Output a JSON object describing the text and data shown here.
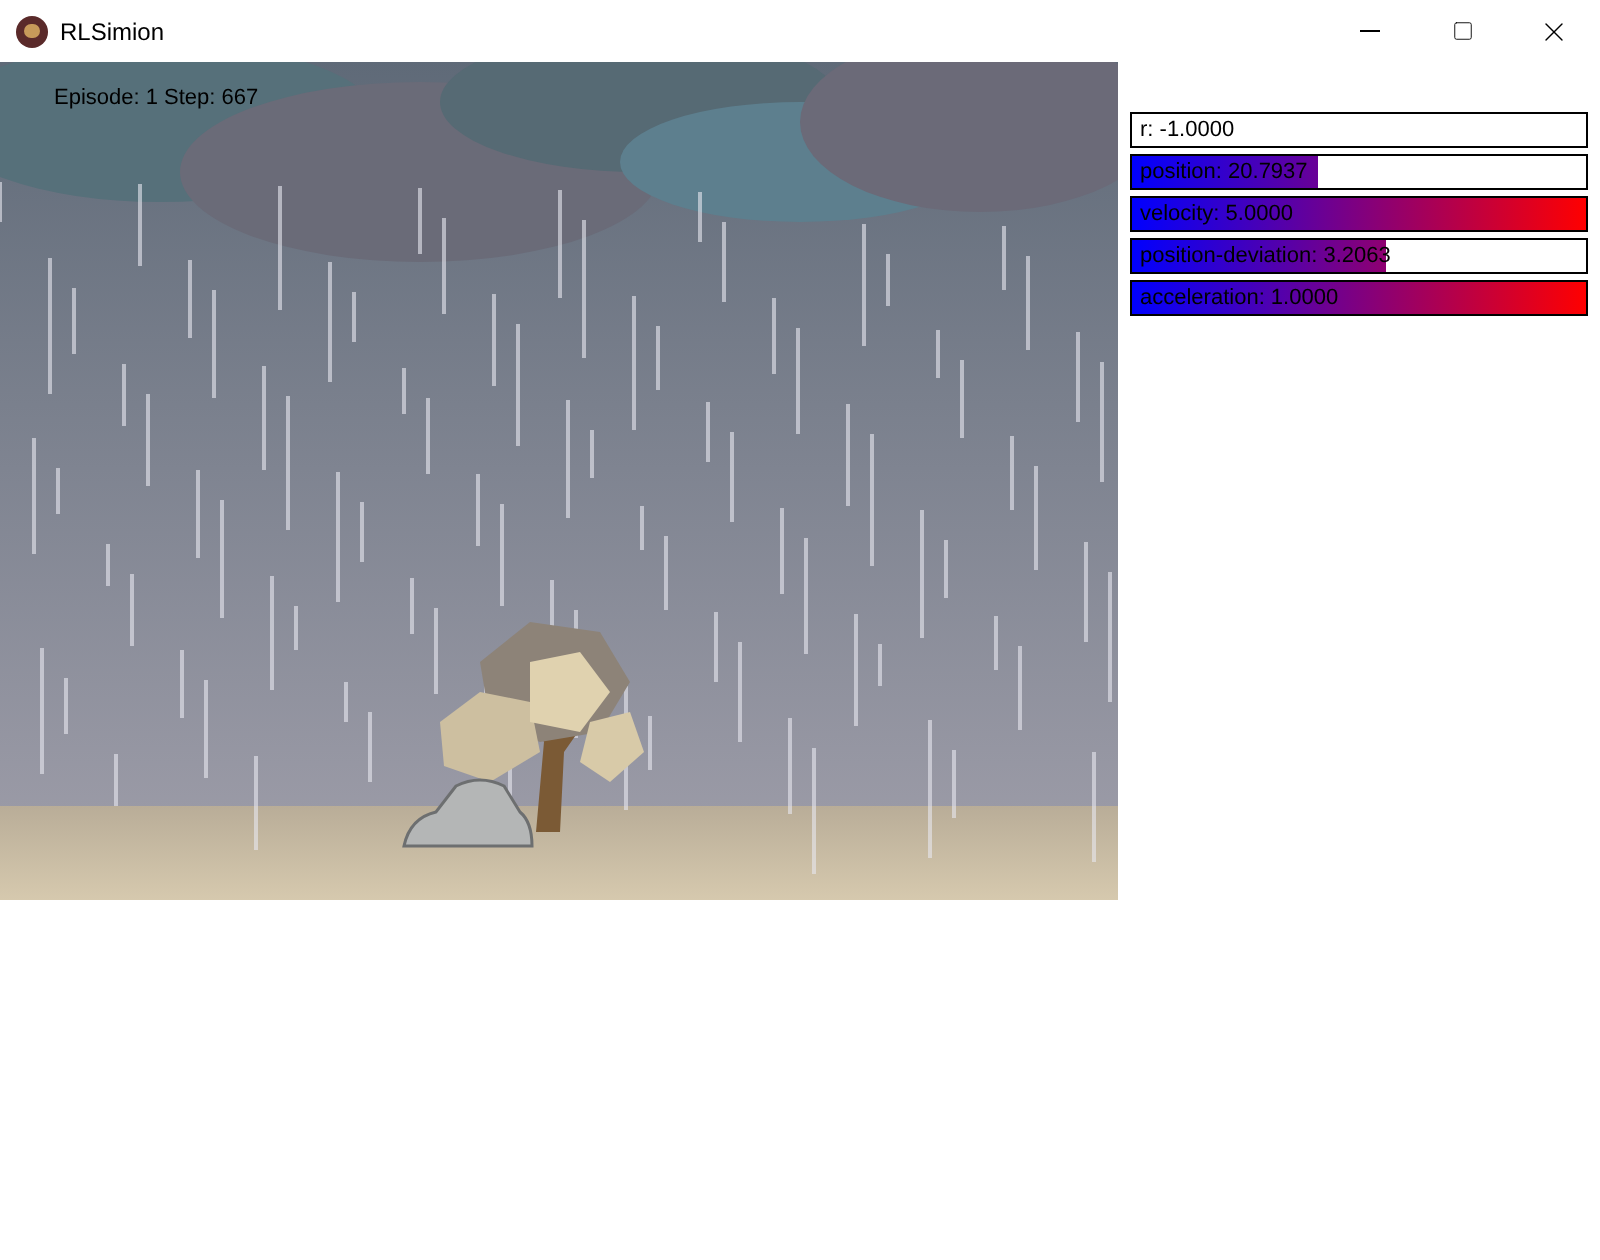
{
  "window": {
    "title": "RLSimion"
  },
  "scene": {
    "overlay_text": "Episode: 1  Step: 667"
  },
  "variables": [
    {
      "label": "r: -1.0000"
    },
    {
      "label": "position: 20.7937",
      "level": 0.41
    },
    {
      "label": "velocity: 5.0000",
      "level": 1
    },
    {
      "label": "position-deviation: 3.2063",
      "level": 0.56
    },
    {
      "label": "acceleration: 1.0000",
      "level": 1
    }
  ]
}
